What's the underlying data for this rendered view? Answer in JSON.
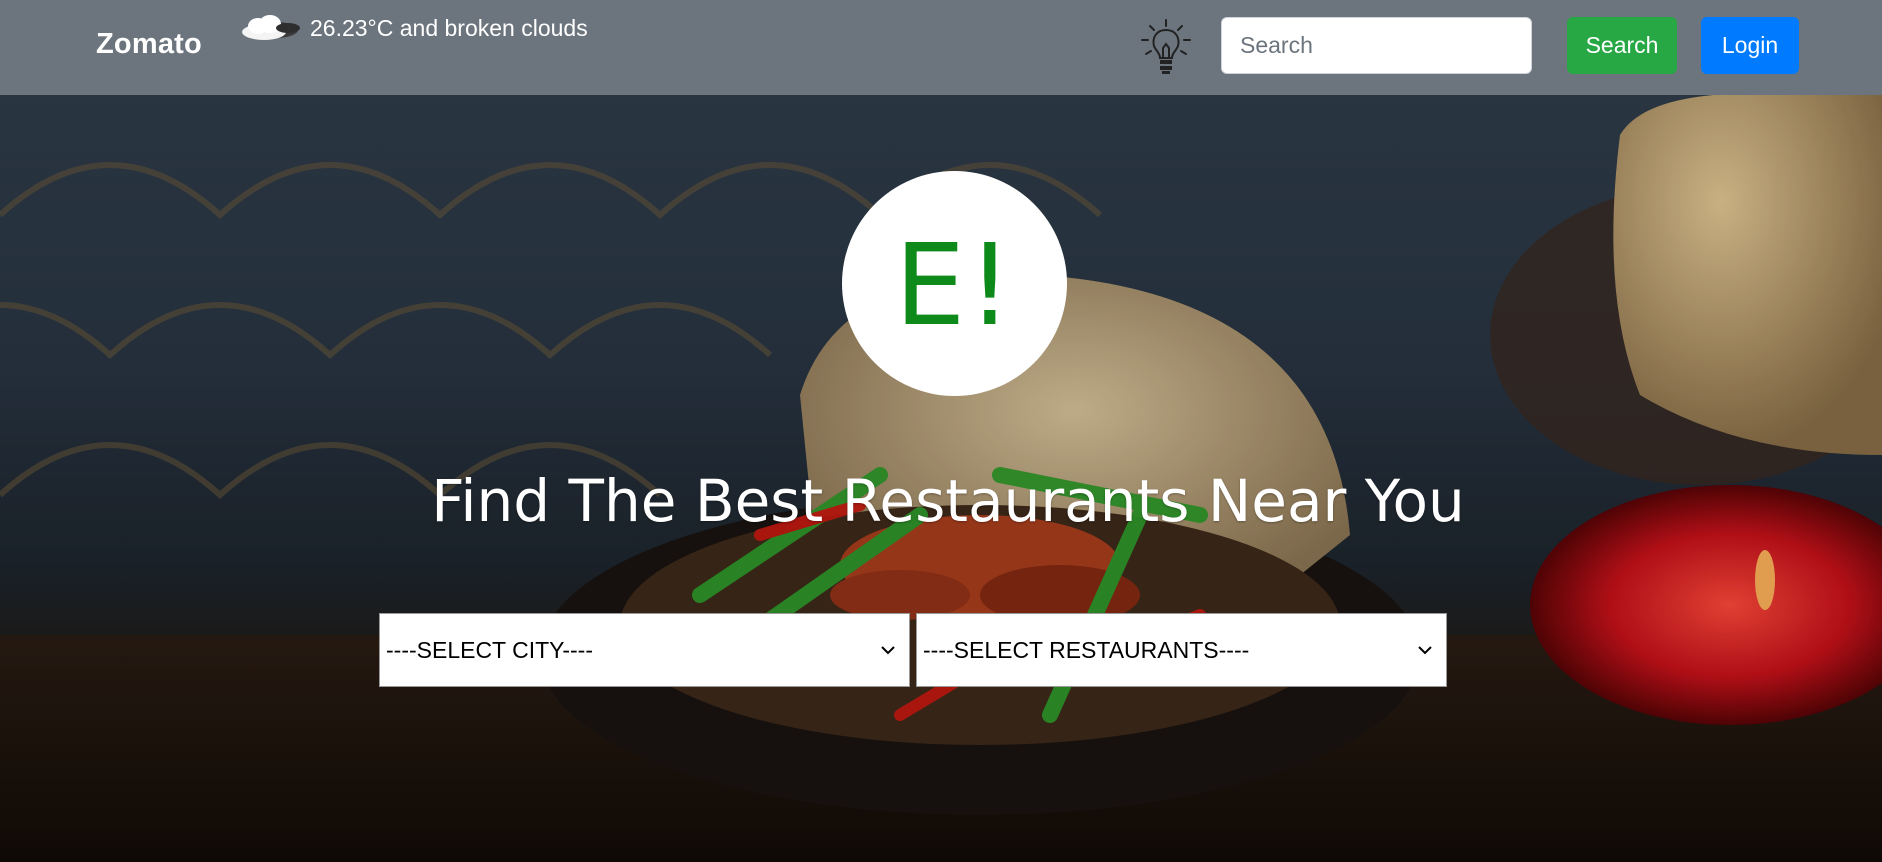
{
  "navbar": {
    "brand": "Zomato",
    "weather_icon": "cloud-icon",
    "weather_text": "26.23°C and broken clouds",
    "theme_icon": "lightbulb-icon",
    "search_placeholder": "Search",
    "search_button": "Search",
    "login_button": "Login",
    "colors": {
      "navbar_bg": "#6c757d",
      "search_btn": "#28a745",
      "login_btn": "#007bff"
    }
  },
  "hero": {
    "logo_text": "E!",
    "logo_color": "#0d8a1a",
    "headline": "Find The Best Restaurants Near You",
    "city_select": {
      "selected": "----SELECT CITY----"
    },
    "restaurant_select": {
      "selected": "----SELECT RESTAURANTS----"
    }
  }
}
